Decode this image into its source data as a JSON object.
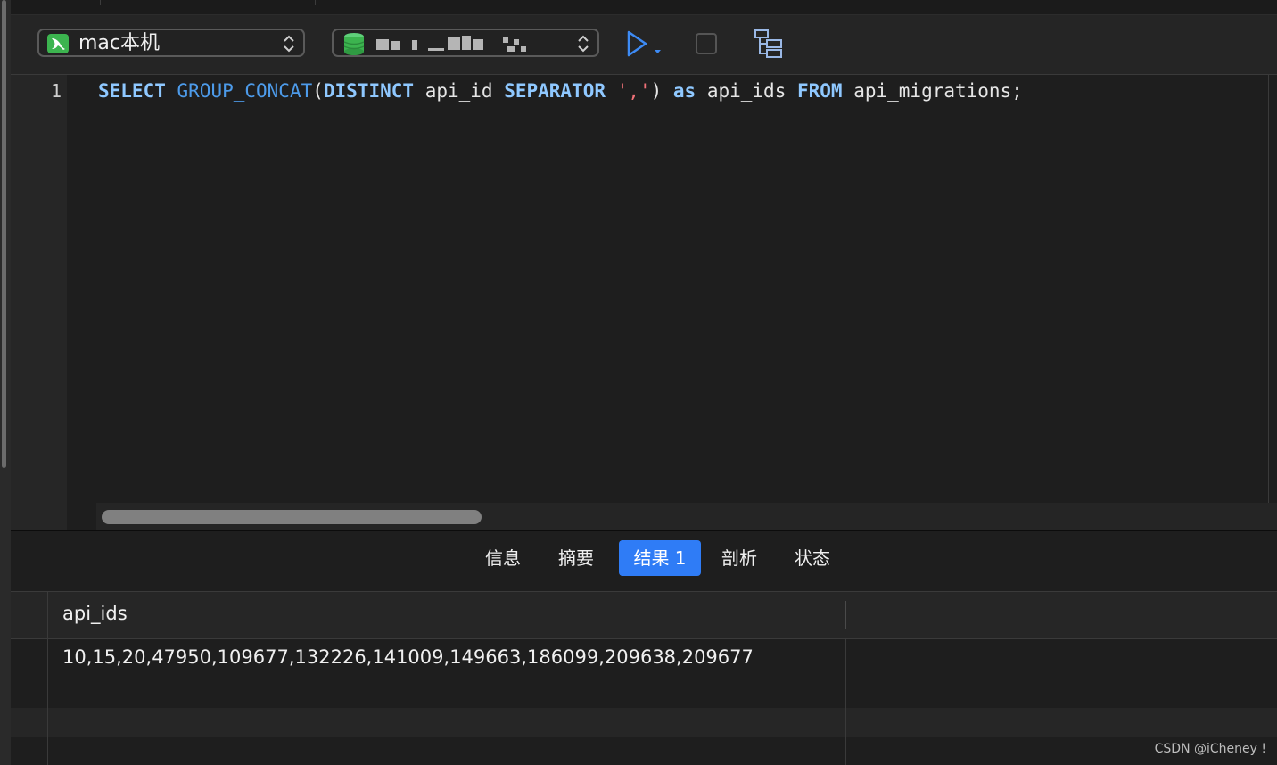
{
  "toolbar": {
    "connection_label": "mac本机",
    "database_label": "",
    "colors": {
      "accent": "#2f7cf6",
      "run": "#3d8bf5",
      "connection_icon": "#3cb44f",
      "db_icon": "#3cb44f"
    }
  },
  "editor": {
    "line_number": "1",
    "code": {
      "t1": "SELECT",
      "t2": "GROUP_CONCAT",
      "t3": "(",
      "t4": "DISTINCT",
      "t5": " api_id ",
      "t6": "SEPARATOR",
      "t7": "','",
      "t8": ") ",
      "t9": "as",
      "t10": " api_ids ",
      "t11": "FROM",
      "t12": " api_migrations;"
    }
  },
  "result_tabs": [
    {
      "label": "信息"
    },
    {
      "label": "摘要"
    },
    {
      "label": "结果 1",
      "active": true
    },
    {
      "label": "剖析"
    },
    {
      "label": "状态"
    }
  ],
  "grid": {
    "column_header": "api_ids",
    "rows": [
      "10,15,20,47950,109677,132226,141009,149663,186099,209638,209677"
    ]
  },
  "watermark": "CSDN @iCheney !"
}
